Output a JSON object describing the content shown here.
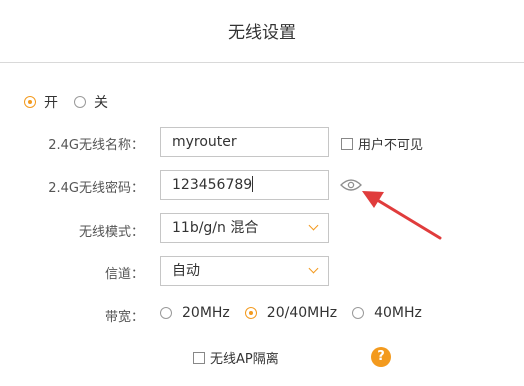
{
  "page": {
    "title": "无线设置"
  },
  "power": {
    "on_label": "开",
    "off_label": "关",
    "selected": "on"
  },
  "ssid": {
    "label": "2.4G无线名称：",
    "value": "myrouter",
    "hide_label": "用户不可见"
  },
  "password": {
    "label": "2.4G无线密码：",
    "value": "123456789",
    "reveal_icon": "eye-icon"
  },
  "mode": {
    "label": "无线模式：",
    "value": "11b/g/n 混合"
  },
  "channel": {
    "label": "信道：",
    "value": "自动"
  },
  "bandwidth": {
    "label": "带宽：",
    "options": [
      "20MHz",
      "20/40MHz",
      "40MHz"
    ],
    "selected": "20/40MHz"
  },
  "ap_isolation": {
    "label": "无线AP隔离"
  },
  "help": {
    "icon": "question-icon",
    "text": "?"
  },
  "annotation": {
    "icon": "red-arrow-icon",
    "color": "#e03c3c"
  },
  "colors": {
    "accent": "#f39a1e",
    "arrow": "#e03c3c"
  }
}
